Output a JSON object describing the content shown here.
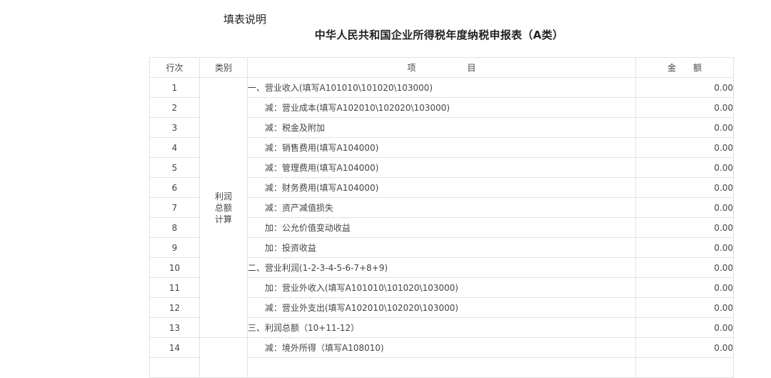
{
  "help_link": "填表说明",
  "title": "中华人民共和国企业所得税年度纳税申报表（A类）",
  "table": {
    "headers": {
      "row_no": "行次",
      "category": "类别",
      "item": "项　　　　　　目",
      "amount": "金　　额"
    },
    "category_profit": [
      "利润",
      "总额",
      "计算"
    ],
    "rows": [
      {
        "no": "1",
        "item": "一、营业收入(填写A101010\\101020\\103000)",
        "amount": "0.00",
        "level": 1
      },
      {
        "no": "2",
        "item": "减：营业成本(填写A102010\\102020\\103000)",
        "amount": "0.00",
        "level": 2
      },
      {
        "no": "3",
        "item": "减：税金及附加",
        "amount": "0.00",
        "level": 2
      },
      {
        "no": "4",
        "item": "减：销售费用(填写A104000)",
        "amount": "0.00",
        "level": 2
      },
      {
        "no": "5",
        "item": "减：管理费用(填写A104000)",
        "amount": "0.00",
        "level": 2
      },
      {
        "no": "6",
        "item": "减：财务费用(填写A104000)",
        "amount": "0.00",
        "level": 2
      },
      {
        "no": "7",
        "item": "减：资产减值损失",
        "amount": "0.00",
        "level": 2
      },
      {
        "no": "8",
        "item": "加：公允价值变动收益",
        "amount": "0.00",
        "level": 2
      },
      {
        "no": "9",
        "item": "加：投资收益",
        "amount": "0.00",
        "level": 2
      },
      {
        "no": "10",
        "item": "二、营业利润(1-2-3-4-5-6-7+8+9)",
        "amount": "0.00",
        "level": 1
      },
      {
        "no": "11",
        "item": "加：营业外收入(填写A101010\\101020\\103000)",
        "amount": "0.00",
        "level": 2
      },
      {
        "no": "12",
        "item": "减：营业外支出(填写A102010\\102020\\103000)",
        "amount": "0.00",
        "level": 2
      },
      {
        "no": "13",
        "item": "三、利润总额（10+11-12）",
        "amount": "0.00",
        "level": 1
      },
      {
        "no": "14",
        "item": "减：境外所得（填写A108010)",
        "amount": "0.00",
        "level": 2
      }
    ]
  }
}
